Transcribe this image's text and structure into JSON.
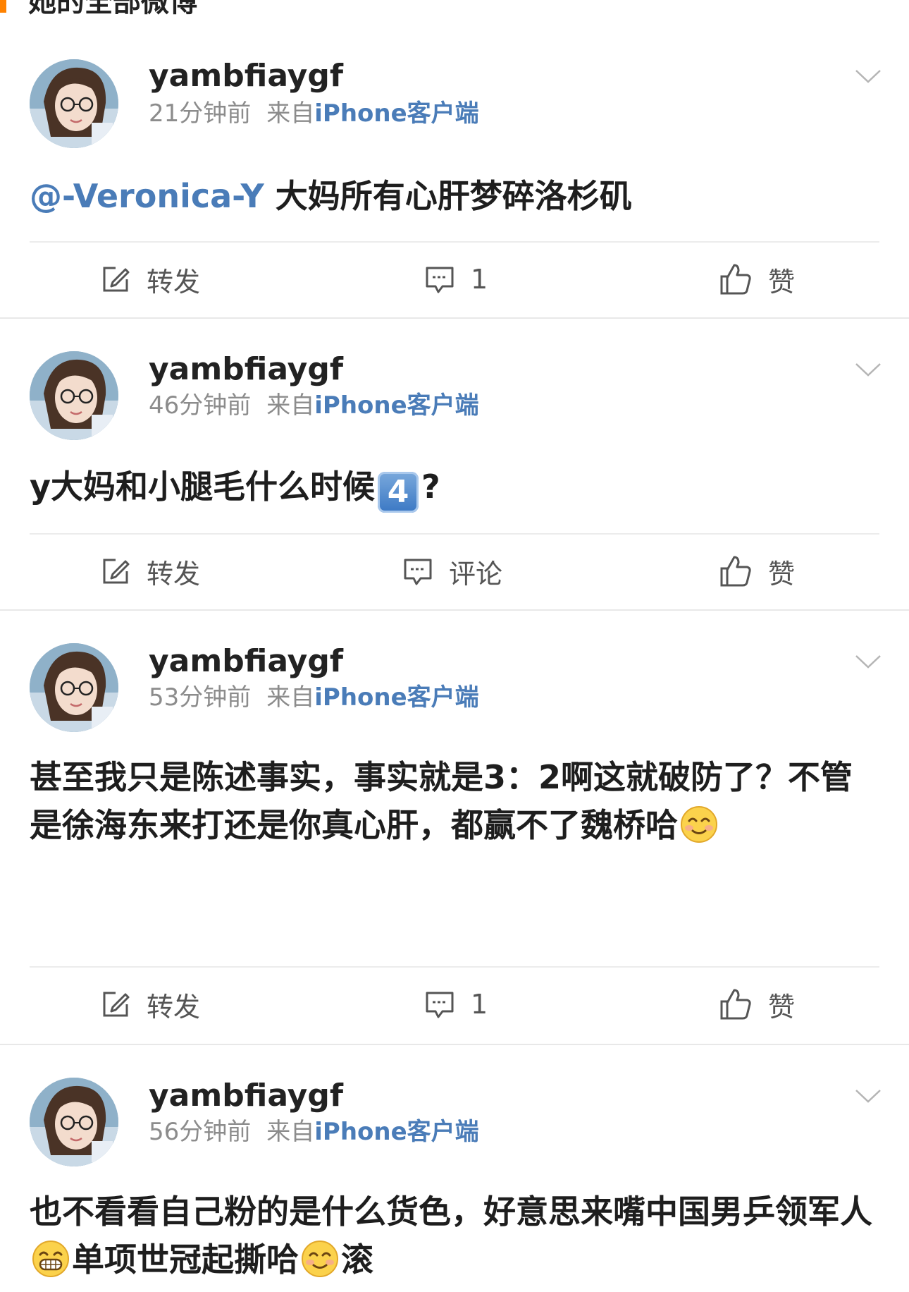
{
  "header": {
    "title": "她的全部微博"
  },
  "posts": [
    {
      "username": "yambfiaygf",
      "time": "21分钟前",
      "source_prefix": "来自",
      "source_app": "iPhone客户端",
      "mention": "@-Veronica-Y",
      "text": " 大妈所有心肝梦碎洛杉矶",
      "actions": {
        "repost": "转发",
        "comment": "1",
        "like": "赞"
      }
    },
    {
      "username": "yambfiaygf",
      "time": "46分钟前",
      "source_prefix": "来自",
      "source_app": "iPhone客户端",
      "text_before": "y大妈和小腿毛什么时候",
      "keycap": "4",
      "text_after": "?",
      "actions": {
        "repost": "转发",
        "comment": "评论",
        "like": "赞"
      }
    },
    {
      "username": "yambfiaygf",
      "time": "53分钟前",
      "source_prefix": "来自",
      "source_app": "iPhone客户端",
      "text": "甚至我只是陈述事实，事实就是3：2啊这就破防了？不管是徐海东来打还是你真心肝，都赢不了魏桥哈",
      "actions": {
        "repost": "转发",
        "comment": "1",
        "like": "赞"
      }
    },
    {
      "username": "yambfiaygf",
      "time": "56分钟前",
      "source_prefix": "来自",
      "source_app": "iPhone客户端",
      "text_part1": "也不看看自己粉的是什么货色，好意思来嘴中国男乒领军人",
      "text_part2": "单项世冠起撕哈",
      "text_part3": "滚"
    }
  ],
  "colors": {
    "link": "#4a7cb8",
    "meta": "#8c8c8c",
    "accent": "#ff8200"
  },
  "icons": [
    "avatar",
    "chevron-down-icon",
    "repost-icon",
    "comment-icon",
    "like-icon",
    "smile-emoji",
    "grin-emoji",
    "keycap-4-emoji"
  ]
}
